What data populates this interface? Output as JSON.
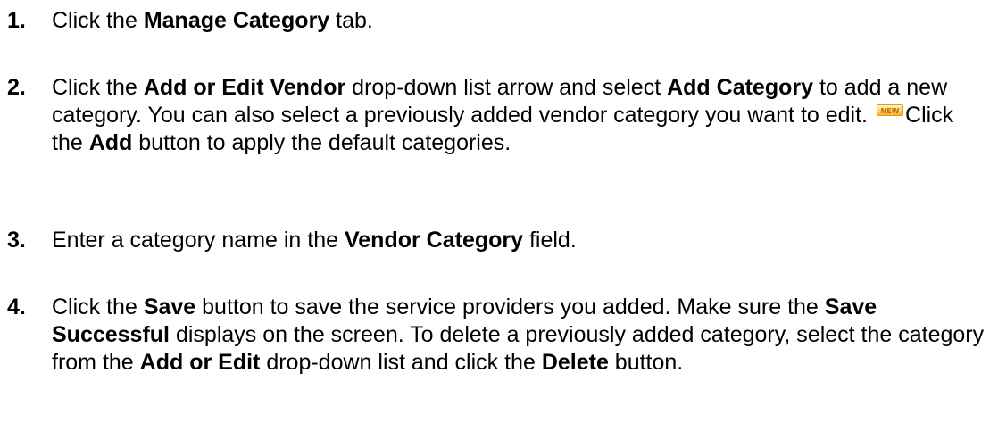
{
  "steps": [
    {
      "number": "1.",
      "parts": [
        "Click the ",
        "Manage Category",
        " tab."
      ]
    },
    {
      "number": "2.",
      "parts": [
        "Click the ",
        "Add or Edit Vendor",
        " drop-down list arrow and select ",
        "Add Category",
        " to add a new category.  You can also select a previously added vendor category you want to edit.",
        "NEW",
        "Click the ",
        "Add",
        " button to apply the default categories."
      ]
    },
    {
      "number": "3.",
      "parts": [
        "Enter a category name in the ",
        "Vendor Category",
        " field."
      ]
    },
    {
      "number": "4.",
      "parts": [
        "Click the ",
        "Save",
        " button to save the service providers you added.  Make sure the ",
        "Save Successful",
        " displays on the screen.  To delete a previously added category, select the category from the ",
        "Add or Edit",
        " drop-down list and click the ",
        "Delete",
        " button."
      ]
    }
  ],
  "badge": {
    "icon": "new-badge-icon",
    "colors": {
      "fill": "#f3b52b",
      "border": "#e29a17",
      "text": "#c76c00"
    }
  }
}
